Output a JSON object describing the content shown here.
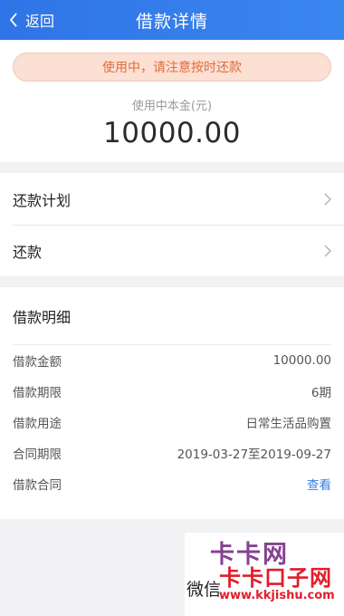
{
  "header": {
    "back_label": "返回",
    "title": "借款详情"
  },
  "summary": {
    "status_banner": "使用中，请注意按时还款",
    "principal_label": "使用中本金(元)",
    "principal_value": "10000.00"
  },
  "menu": {
    "items": [
      {
        "label": "还款计划"
      },
      {
        "label": "还款"
      }
    ]
  },
  "details": {
    "title": "借款明细",
    "rows": [
      {
        "label": "借款金额",
        "value": "10000.00"
      },
      {
        "label": "借款期限",
        "value": "6期"
      },
      {
        "label": "借款用途",
        "value": "日常生活品购置"
      },
      {
        "label": "合同期限",
        "value": "2019-03-27至2019-09-27"
      },
      {
        "label": "借款合同",
        "value": "查看"
      }
    ]
  },
  "watermark": {
    "faint_text": "卡卡网",
    "main_text": "卡卡口子网",
    "url": "www.kkjishu.com",
    "left_text": "微信"
  },
  "colors": {
    "header": "#2f74e6",
    "banner_text": "#e06b3d",
    "link": "#3a7fe0",
    "watermark": "#e11d2a"
  }
}
